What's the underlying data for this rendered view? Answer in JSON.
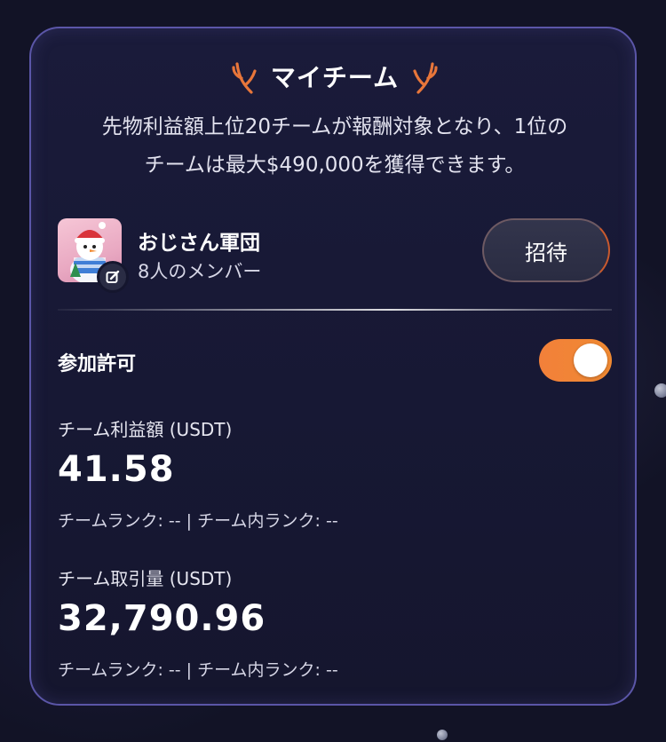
{
  "card": {
    "title": "マイチーム",
    "description_line1": "先物利益額上位20チームが報酬対象となり、1位の",
    "description_line2": "チームは最大$490,000を獲得できます。"
  },
  "team": {
    "name": "おじさん軍団",
    "members": "8人のメンバー",
    "invite_label": "招待"
  },
  "permission": {
    "label": "参加許可",
    "enabled": true
  },
  "profit": {
    "label": "チーム利益額 (USDT)",
    "value": "41.58",
    "rank_line": "チームランク: -- | チーム内ランク: --"
  },
  "volume": {
    "label": "チーム取引量 (USDT)",
    "value": "32,790.96",
    "rank_line": "チームランク: -- | チーム内ランク: --"
  },
  "colors": {
    "accent": "#f2803a",
    "border": "#5b56a8",
    "background": "#121326"
  }
}
